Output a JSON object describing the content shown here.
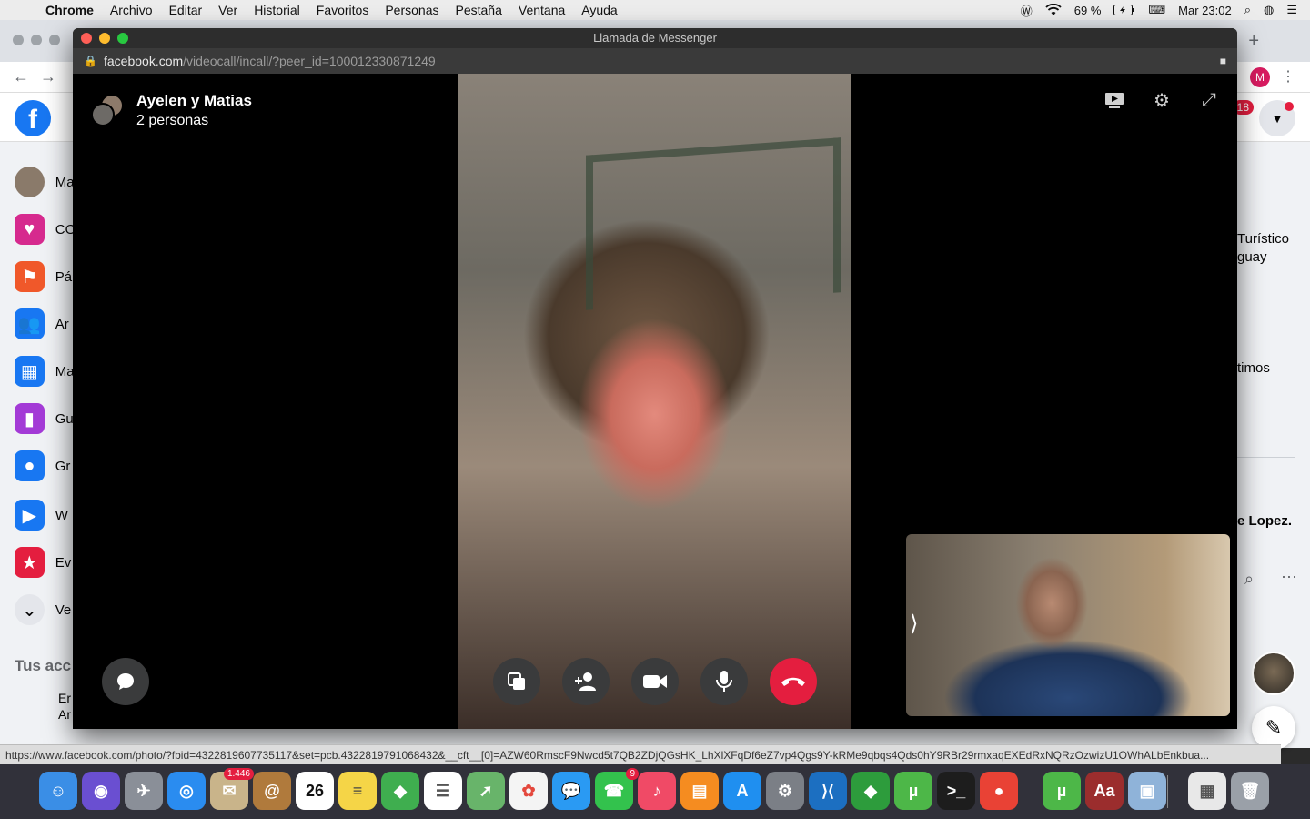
{
  "menubar": {
    "app": "Chrome",
    "items": [
      "Archivo",
      "Editar",
      "Ver",
      "Historial",
      "Favoritos",
      "Personas",
      "Pestaña",
      "Ventana",
      "Ayuda"
    ],
    "battery": "69 %",
    "clock": "Mar 23:02"
  },
  "background_browser": {
    "profile_initial": "M",
    "notification_count": "18",
    "sidebar": [
      {
        "label": "Ma",
        "icon": "avatar-icon",
        "color": "#8a7a6a"
      },
      {
        "label": "CO",
        "icon": "covid-heart-icon",
        "color": "#d62a8e"
      },
      {
        "label": "Pá",
        "icon": "pages-flag-icon",
        "color": "#f0582a"
      },
      {
        "label": "Ar",
        "icon": "friends-icon",
        "color": "#1877f2"
      },
      {
        "label": "Ma",
        "icon": "marketplace-icon",
        "color": "#1877f2"
      },
      {
        "label": "Gu",
        "icon": "saved-bookmark-icon",
        "color": "#a33ad6"
      },
      {
        "label": "Gr",
        "icon": "groups-icon",
        "color": "#1877f2"
      },
      {
        "label": "W",
        "icon": "watch-icon",
        "color": "#1877f2"
      },
      {
        "label": "Ev",
        "icon": "events-icon",
        "color": "#e41e3f"
      },
      {
        "label": "Ve",
        "icon": "chevron-down-icon",
        "color": "#e4e6eb"
      }
    ],
    "accounts_heading": "Tus acc",
    "account_item": "Er Ar",
    "right_column": {
      "promo_line1": "Turístico",
      "promo_line2": "guay",
      "section_2": "timos",
      "contact": "e Lopez."
    }
  },
  "call_window": {
    "title": "Llamada de Messenger",
    "url_domain": "facebook.com",
    "url_path": "/videocall/incall/?peer_id=100012330871249",
    "call_name": "Ayelen y Matias",
    "call_participants": "2 personas"
  },
  "status_url": "https://www.facebook.com/photo/?fbid=4322819607735117&set=pcb.4322819791068432&__cft__[0]=AZW60RmscF9Nwcd5t7QB2ZDjQGsHK_LhXlXFqDf6eZ7vp4Qgs9Y-kRMe9qbqs4Qds0hY9RBr29rmxaqEXEdRxNQRzOzwizU1OWhALbEnkbua...",
  "dock": {
    "items": [
      {
        "name": "finder-icon",
        "color": "#3a8ee6",
        "glyph": "☺"
      },
      {
        "name": "siri-icon",
        "color": "#6a4fd1",
        "glyph": "◉"
      },
      {
        "name": "launchpad-icon",
        "color": "#8a8f98",
        "glyph": "✈"
      },
      {
        "name": "safari-icon",
        "color": "#2a8cf0",
        "glyph": "◎"
      },
      {
        "name": "mail-icon",
        "color": "#c9b48a",
        "glyph": "✉",
        "badge": "1.446"
      },
      {
        "name": "contacts-icon",
        "color": "#b07a3c",
        "glyph": "@"
      },
      {
        "name": "calendar-icon",
        "color": "#ffffff",
        "glyph": "26",
        "text_color": "#111"
      },
      {
        "name": "notes-icon",
        "color": "#f5d547",
        "glyph": "≡",
        "text_color": "#444"
      },
      {
        "name": "sims-icon",
        "color": "#3fae4f",
        "glyph": "◆"
      },
      {
        "name": "reminders-icon",
        "color": "#ffffff",
        "glyph": "☰",
        "text_color": "#555"
      },
      {
        "name": "maps-icon",
        "color": "#68b46a",
        "glyph": "➚"
      },
      {
        "name": "photos-icon",
        "color": "#f4f4f4",
        "glyph": "✿",
        "text_color": "#e4483d"
      },
      {
        "name": "messages-icon",
        "color": "#2a9af3",
        "glyph": "💬"
      },
      {
        "name": "facetime-icon",
        "color": "#33c24d",
        "glyph": "☎",
        "badge": "9"
      },
      {
        "name": "music-icon",
        "color": "#f04a66",
        "glyph": "♪"
      },
      {
        "name": "books-icon",
        "color": "#f58c20",
        "glyph": "▤"
      },
      {
        "name": "app-store-icon",
        "color": "#1f8ff0",
        "glyph": "A"
      },
      {
        "name": "system-preferences-icon",
        "color": "#7b7f86",
        "glyph": "⚙"
      },
      {
        "name": "vscode-icon",
        "color": "#1c6fc1",
        "glyph": "⟩⟨"
      },
      {
        "name": "sims-diamond-icon",
        "color": "#2d9c3c",
        "glyph": "◆"
      },
      {
        "name": "utorrent-icon",
        "color": "#4db748",
        "glyph": "µ"
      },
      {
        "name": "terminal-icon",
        "color": "#1d1d1d",
        "glyph": ">_"
      },
      {
        "name": "chrome-icon",
        "color": "#e94235",
        "glyph": "●"
      },
      {
        "name": "utorrent-2-icon",
        "color": "#4db748",
        "glyph": "µ"
      },
      {
        "name": "dictionary-icon",
        "color": "#9b2d2d",
        "glyph": "Aa"
      },
      {
        "name": "preview-icon",
        "color": "#8fb3d9",
        "glyph": "▣"
      },
      {
        "name": "downloads-stack-icon",
        "color": "#e8e8e8",
        "glyph": "▦",
        "text_color": "#555"
      },
      {
        "name": "trash-icon",
        "color": "#9aa0a8",
        "glyph": "🗑"
      }
    ]
  }
}
